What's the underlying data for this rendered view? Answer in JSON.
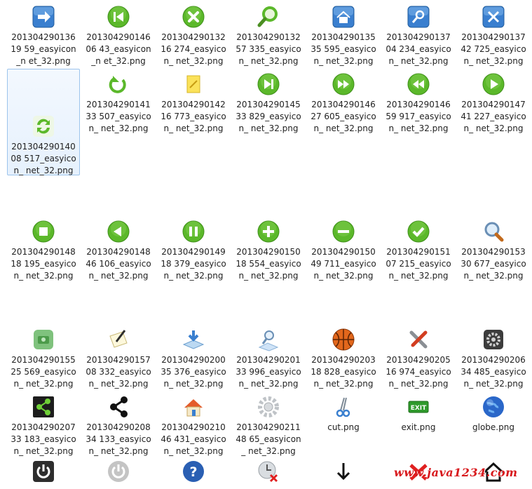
{
  "files": [
    {
      "label": "20130429013619 59_easyicon_n et_32.png",
      "icon": "arrow-right-icon"
    },
    {
      "label": "20130429014606 43_easyicon_n et_32.png",
      "icon": "skip-back-icon"
    },
    {
      "label": "20130429013216 274_easyicon_ net_32.png",
      "icon": "close-circle-icon"
    },
    {
      "label": "20130429013257 335_easyicon_ net_32.png",
      "icon": "magnifier-icon"
    },
    {
      "label": "20130429013535 595_easyicon_ net_32.png",
      "icon": "home-icon"
    },
    {
      "label": "20130429013704 234_easyicon_ net_32.png",
      "icon": "search-tile-icon"
    },
    {
      "label": "20130429013742 725_easyicon_ net_32.png",
      "icon": "tools-tile-icon"
    },
    {
      "label": "20130429014008 517_easyicon_ net_32.png",
      "icon": "refresh-icon",
      "selected": true
    },
    {
      "label": "20130429014133 507_easyicon_ net_32.png",
      "icon": "reload-icon"
    },
    {
      "label": "20130429014216 773_easyicon_ net_32.png",
      "icon": "note-icon"
    },
    {
      "label": "20130429014533 829_easyicon_ net_32.png",
      "icon": "skip-forward-icon"
    },
    {
      "label": "20130429014627 605_easyicon_ net_32.png",
      "icon": "fast-forward-icon"
    },
    {
      "label": "20130429014659 917_easyicon_ net_32.png",
      "icon": "rewind-icon"
    },
    {
      "label": "20130429014741 227_easyicon_ net_32.png",
      "icon": "play-icon"
    },
    {
      "label": "20130429014818 195_easyicon_ net_32.png",
      "icon": "stop-icon"
    },
    {
      "label": "20130429014846 106_easyicon_ net_32.png",
      "icon": "back-icon"
    },
    {
      "label": "20130429014918 379_easyicon_ net_32.png",
      "icon": "pause-icon"
    },
    {
      "label": "20130429015018 554_easyicon_ net_32.png",
      "icon": "plus-icon"
    },
    {
      "label": "20130429015049 711_easyicon_ net_32.png",
      "icon": "minus-icon"
    },
    {
      "label": "20130429015107 215_easyicon_ net_32.png",
      "icon": "check-icon"
    },
    {
      "label": "20130429015330 677_easyicon_ net_32.png",
      "icon": "zoom-icon"
    },
    {
      "label": "20130429015525 569_easyicon_ net_32.png",
      "icon": "camera-icon"
    },
    {
      "label": "20130429015708 332_easyicon_ net_32.png",
      "icon": "pencil-paper-icon"
    },
    {
      "label": "20130429020035 376_easyicon_ net_32.png",
      "icon": "download-tray-icon"
    },
    {
      "label": "20130429020133 996_easyicon_ net_32.png",
      "icon": "search-page-icon"
    },
    {
      "label": "20130429020318 828_easyicon_ net_32.png",
      "icon": "basketball-icon"
    },
    {
      "label": "20130429020516 974_easyicon_ net_32.png",
      "icon": "wrench-screwdriver-icon"
    },
    {
      "label": "20130429020634 485_easyicon_ net_32.png",
      "icon": "gear-box-icon"
    },
    {
      "label": "20130429020733 183_easyicon_ net_32.png",
      "icon": "share-green-icon"
    },
    {
      "label": "20130429020834 133_easyicon_ net_32.png",
      "icon": "share-icon"
    },
    {
      "label": "20130429021046 431_easyicon_ net_32.png",
      "icon": "house-icon"
    },
    {
      "label": "20130429021148 65_easyicon_ net_32.png",
      "icon": "gear-icon"
    },
    {
      "label": "cut.png",
      "icon": "scissors-icon"
    },
    {
      "label": "exit.png",
      "icon": "exit-icon"
    },
    {
      "label": "globe.png",
      "icon": "globe-icon"
    },
    {
      "label": "",
      "icon": "power-dark-icon"
    },
    {
      "label": "",
      "icon": "power-light-icon"
    },
    {
      "label": "",
      "icon": "help-icon"
    },
    {
      "label": "",
      "icon": "clock-delete-icon"
    },
    {
      "label": "",
      "icon": "arrow-down-icon"
    },
    {
      "label": "",
      "icon": "red-x-icon"
    },
    {
      "label": "",
      "icon": "house-outline-icon"
    }
  ],
  "watermark": "www.java1234.com",
  "colors": {
    "green": "#5bb82a",
    "blue": "#3a7fcf",
    "selection_bg": "#e9f2fd",
    "selection_border": "#9cc4ec",
    "watermark": "#d8191d"
  }
}
